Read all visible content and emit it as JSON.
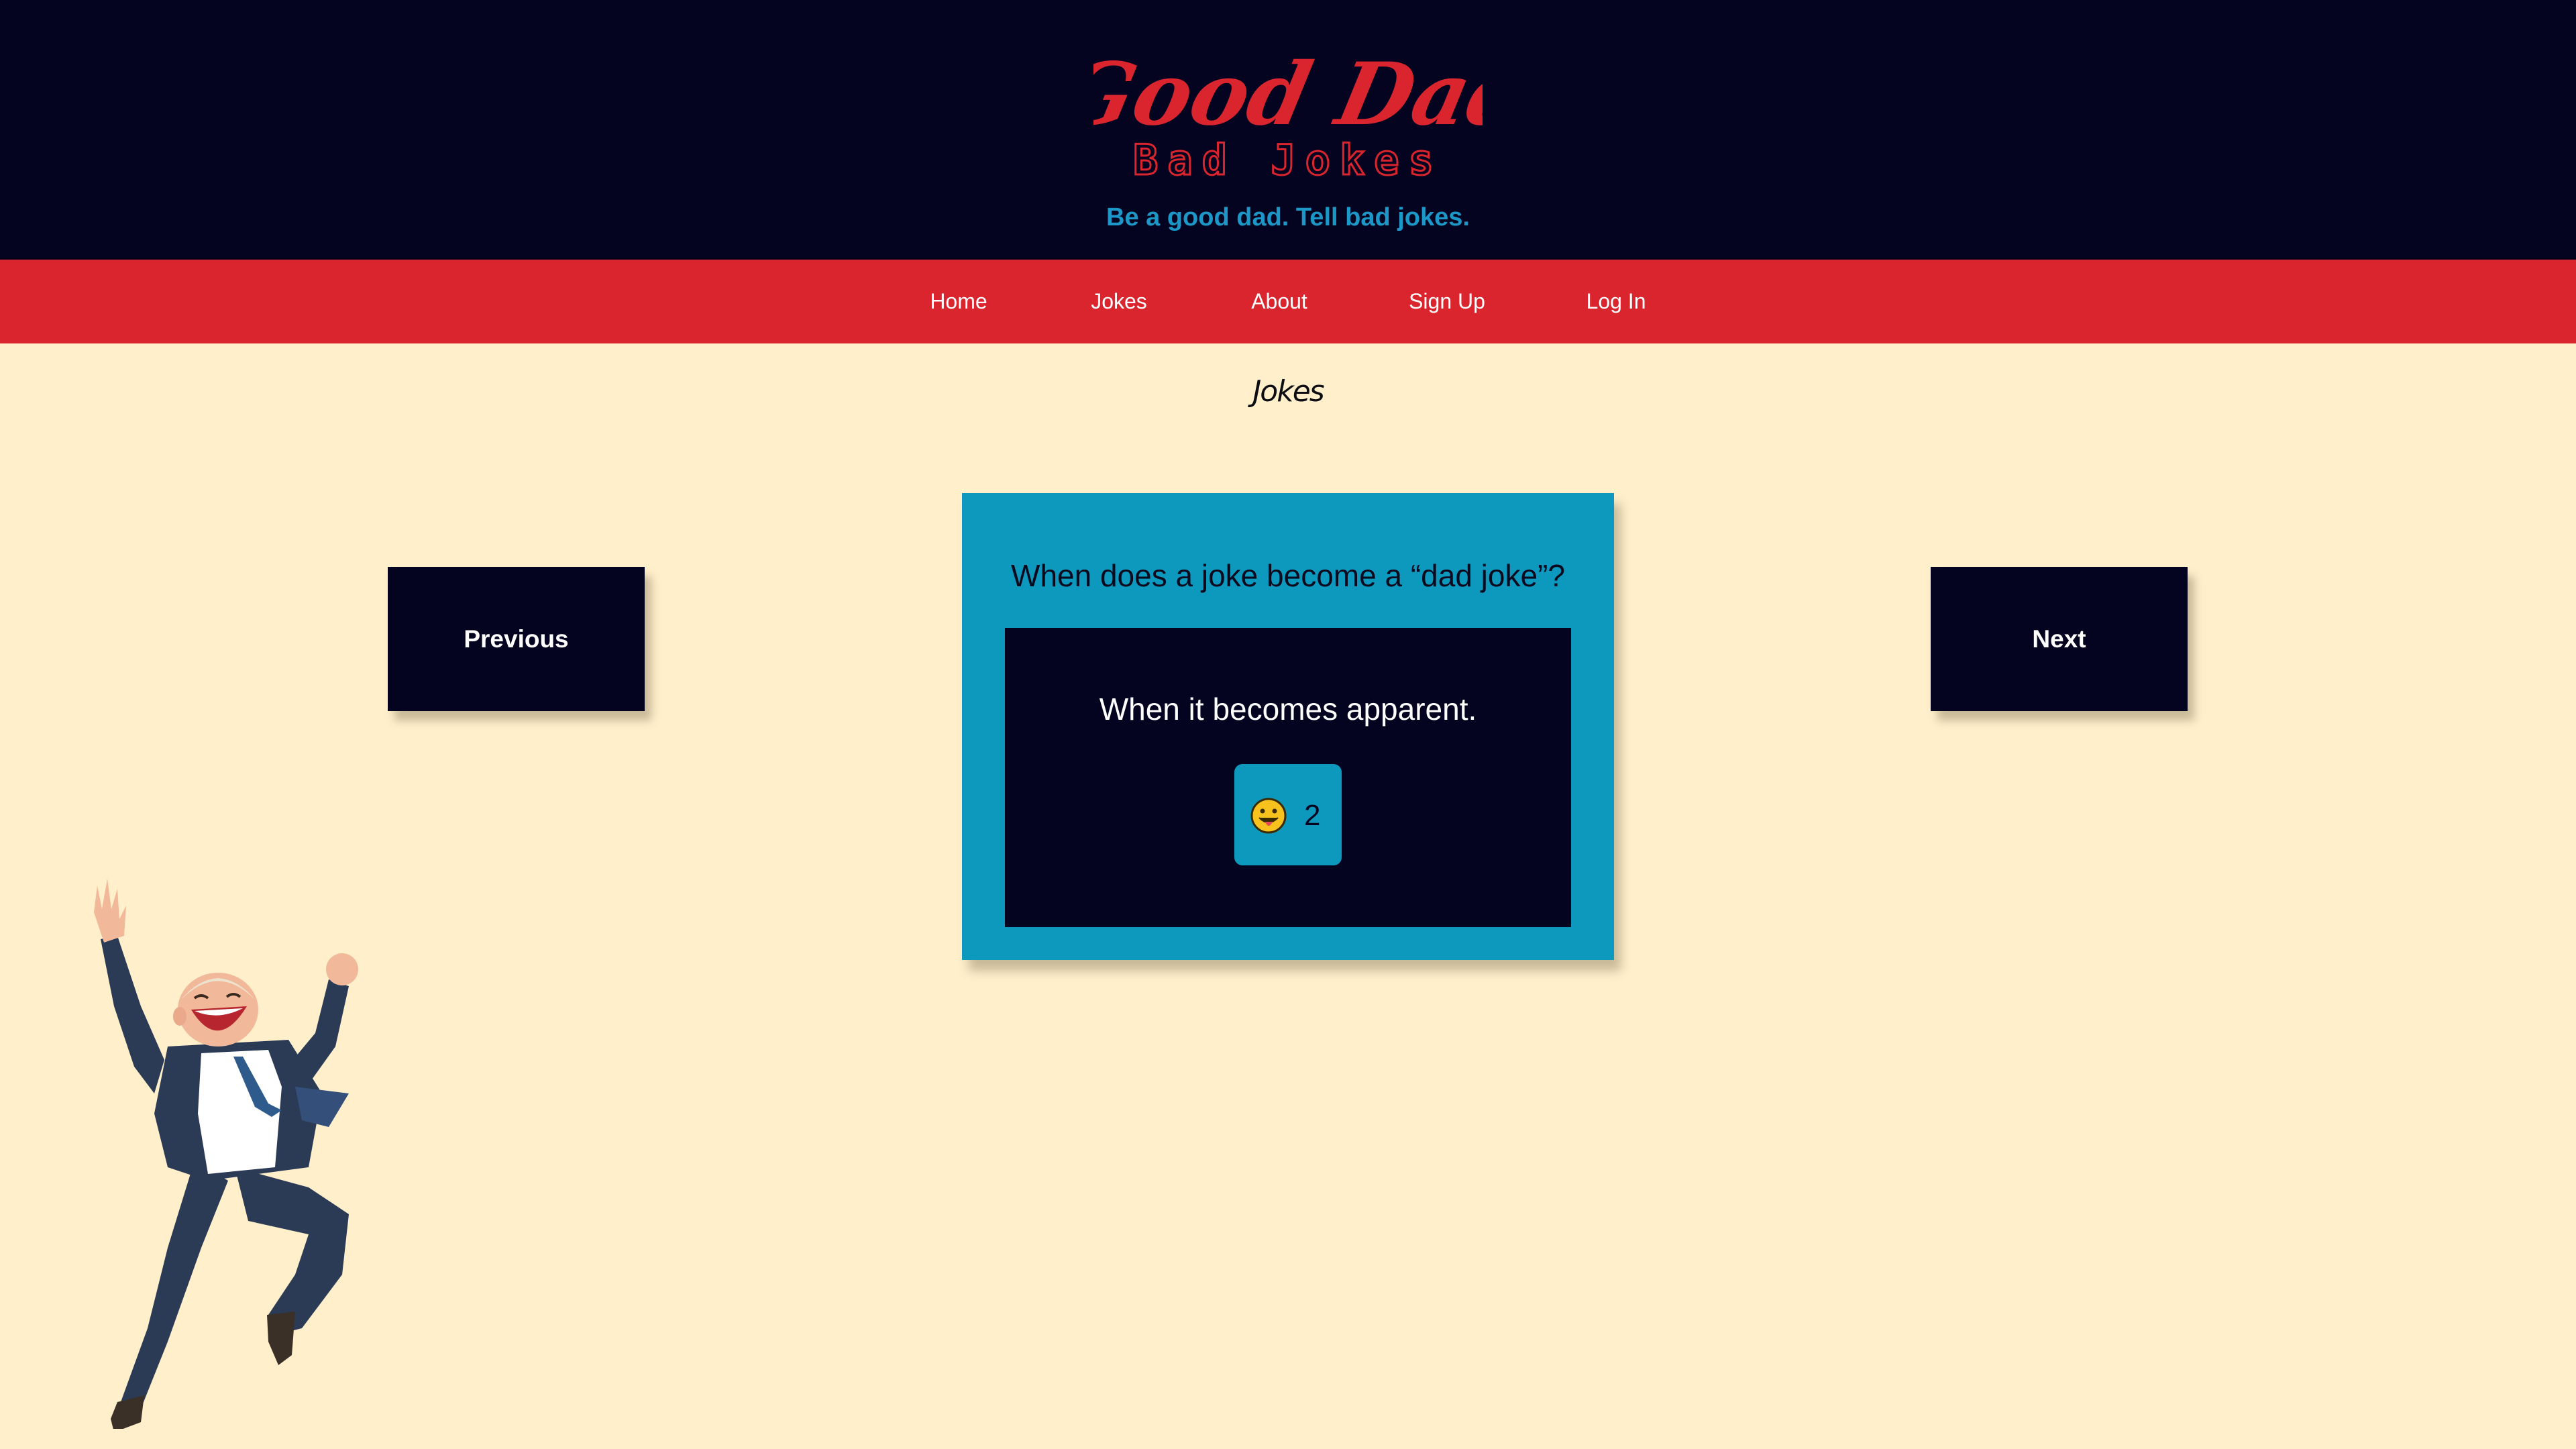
{
  "header": {
    "logo": {
      "line1": "Good Dad",
      "line2": "Bad Jokes"
    },
    "tagline": "Be a good dad. Tell bad jokes."
  },
  "nav": {
    "items": [
      {
        "label": "Home"
      },
      {
        "label": "Jokes"
      },
      {
        "label": "About"
      },
      {
        "label": "Sign Up"
      },
      {
        "label": "Log In"
      }
    ]
  },
  "page": {
    "title": "Jokes"
  },
  "controls": {
    "previous_label": "Previous",
    "next_label": "Next"
  },
  "joke": {
    "question": "When does a joke become a “dad joke”?",
    "answer": "When it becomes apparent.",
    "reaction": {
      "icon": "tongue-out-face-icon",
      "count": "2"
    }
  },
  "colors": {
    "header_bg": "#050420",
    "nav_bg": "#DA252F",
    "page_bg": "#FFEFCB",
    "accent_blue": "#0D98BE",
    "logo_red": "#DA252F",
    "tagline_blue": "#1C98C8"
  }
}
